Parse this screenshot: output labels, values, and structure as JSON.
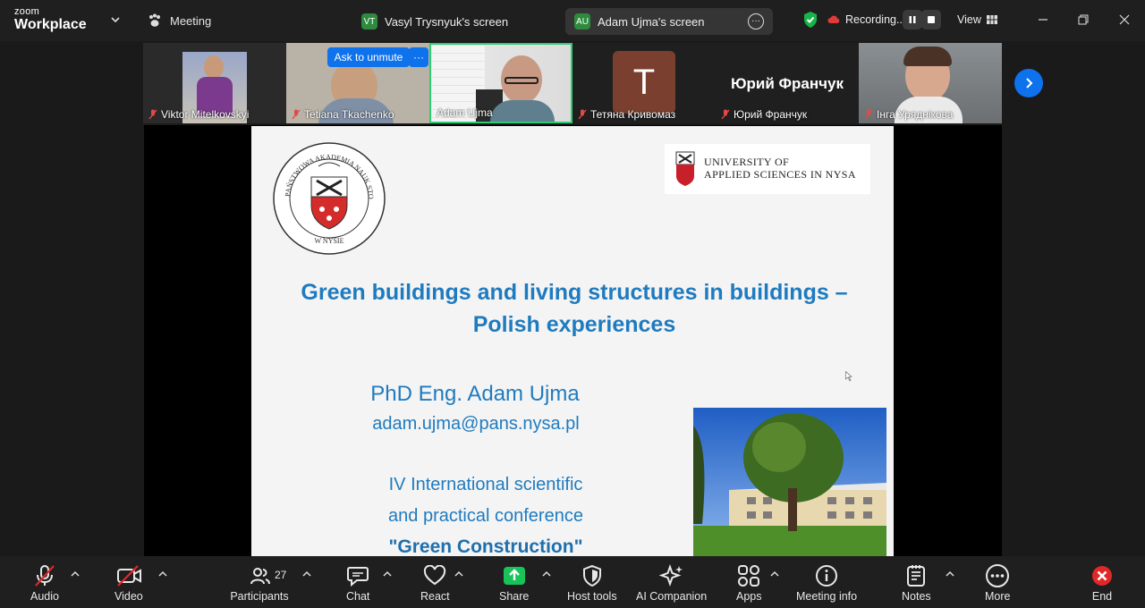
{
  "app": {
    "brand_small": "zoom",
    "brand_large": "Workplace",
    "meeting_label": "Meeting"
  },
  "share_tabs": [
    {
      "initials": "VT",
      "label": "Vasyl Trysnyuk's screen"
    },
    {
      "initials": "AU",
      "label": "Adam Ujma's screen"
    }
  ],
  "recording": {
    "label": "Recording..."
  },
  "view": {
    "label": "View"
  },
  "ask_to_unmute": "Ask to unmute",
  "ask_more": "···",
  "participants": [
    {
      "name": "Viktor Mitelkovskyi",
      "muted": true
    },
    {
      "name": "Tetiana Tkachenko",
      "muted": true
    },
    {
      "name": "Adam Ujma",
      "muted": false
    },
    {
      "name": "Тетяна Кривомаз",
      "muted": true,
      "initial": "T"
    },
    {
      "name": "Юрий Франчук",
      "muted": true,
      "display_text": "Юрий Франчук"
    },
    {
      "name": "Інга Уряднікова",
      "muted": true
    }
  ],
  "slide": {
    "title_line1": "Green buildings and living structures in buildings –",
    "title_line2": "Polish experiences",
    "author": "PhD Eng. Adam Ujma",
    "email": "adam.ujma@pans.nysa.pl",
    "conf_line1": "IV International scientific",
    "conf_line2": "and practical conference",
    "conf_line3": "\"Green Construction\"",
    "uni_line1": "UNIVERSITY OF",
    "uni_line2": "APPLIED SCIENCES IN NYSA"
  },
  "toolbar": {
    "audio": "Audio",
    "video": "Video",
    "participants": "Participants",
    "participants_count": "27",
    "chat": "Chat",
    "react": "React",
    "share": "Share",
    "host_tools": "Host tools",
    "ai_companion": "AI Companion",
    "apps": "Apps",
    "meeting_info": "Meeting info",
    "notes": "Notes",
    "more": "More",
    "end": "End"
  },
  "colors": {
    "accent": "#0e72ed",
    "slide_blue": "#1f7bbf",
    "share_green": "#19c35a",
    "end_red": "#e02828",
    "active_border": "#2ecc71"
  }
}
